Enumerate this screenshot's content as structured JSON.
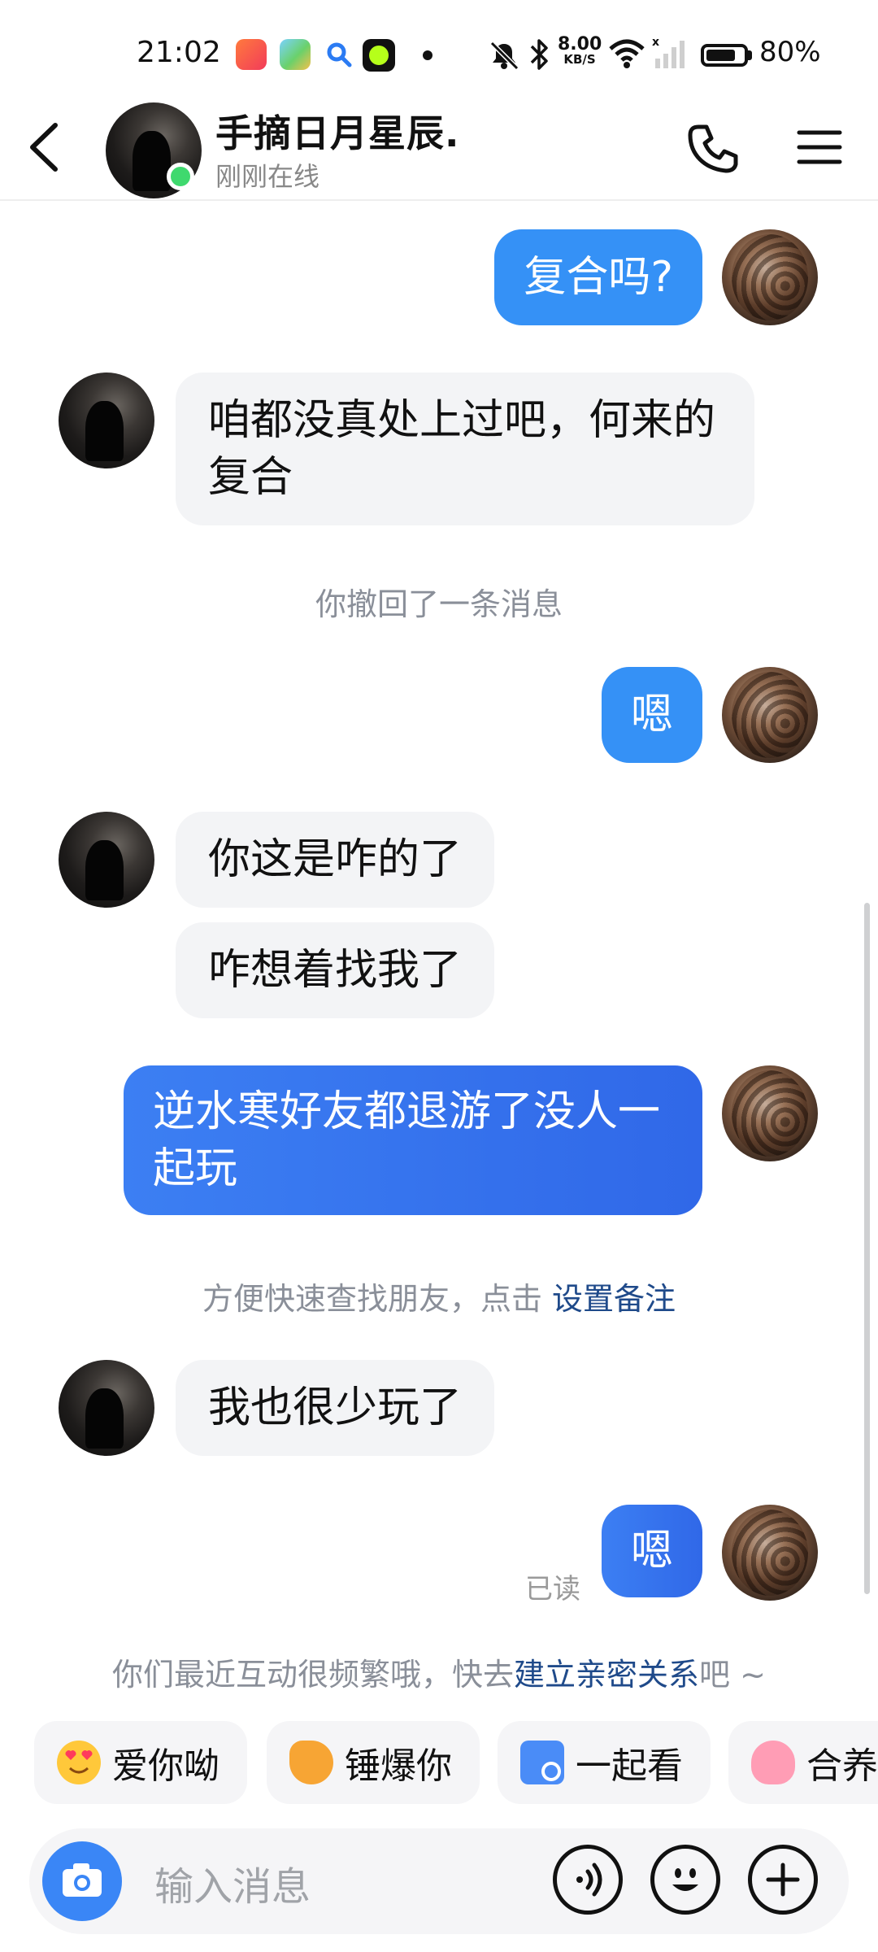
{
  "status_bar": {
    "time": "21:02",
    "net_speed_value": "8.00",
    "net_speed_unit": "KB/S",
    "battery": "80%",
    "battery_level_percent": 80,
    "icons": [
      "video-app-icon",
      "game-app-icon",
      "search-app-icon",
      "camera-app-icon",
      "dot-icon",
      "mute-icon",
      "bluetooth-icon",
      "wifi-icon",
      "signal-icon",
      "battery-icon"
    ]
  },
  "header": {
    "name": "手摘日月星辰.",
    "status": "刚刚在线"
  },
  "messages": [
    {
      "from": "me",
      "text": "复合吗?"
    },
    {
      "from": "them",
      "text": "咱都没真处上过吧，何来的复合"
    },
    {
      "type": "system",
      "text": "你撤回了一条消息"
    },
    {
      "from": "me",
      "text": "嗯"
    },
    {
      "from": "them",
      "text": "你这是咋的了"
    },
    {
      "from": "them",
      "text": "咋想着找我了"
    },
    {
      "from": "me",
      "text": "逆水寒好友都退游了没人一起玩"
    },
    {
      "type": "system",
      "text": "方便快速查找朋友，点击 ",
      "link": "设置备注"
    },
    {
      "from": "them",
      "text": "我也很少玩了"
    },
    {
      "from": "me",
      "text": "嗯",
      "read": "已读"
    }
  ],
  "suggestion": {
    "prefix": "你们最近互动很频繁哦，快去",
    "link": "建立亲密关系",
    "suffix": "吧 ~"
  },
  "chips": [
    {
      "label": "爱你呦",
      "icon": "heart-eyes-emoji-icon"
    },
    {
      "label": "锤爆你",
      "icon": "hammer-emoji-icon"
    },
    {
      "label": "一起看",
      "icon": "watch-together-icon"
    },
    {
      "label": "合养",
      "icon": "pet-emoji-icon"
    }
  ],
  "input": {
    "placeholder": "输入消息"
  },
  "colors": {
    "accent": "#3591f6",
    "online": "#3fd96e",
    "link": "#1f4a8a"
  }
}
